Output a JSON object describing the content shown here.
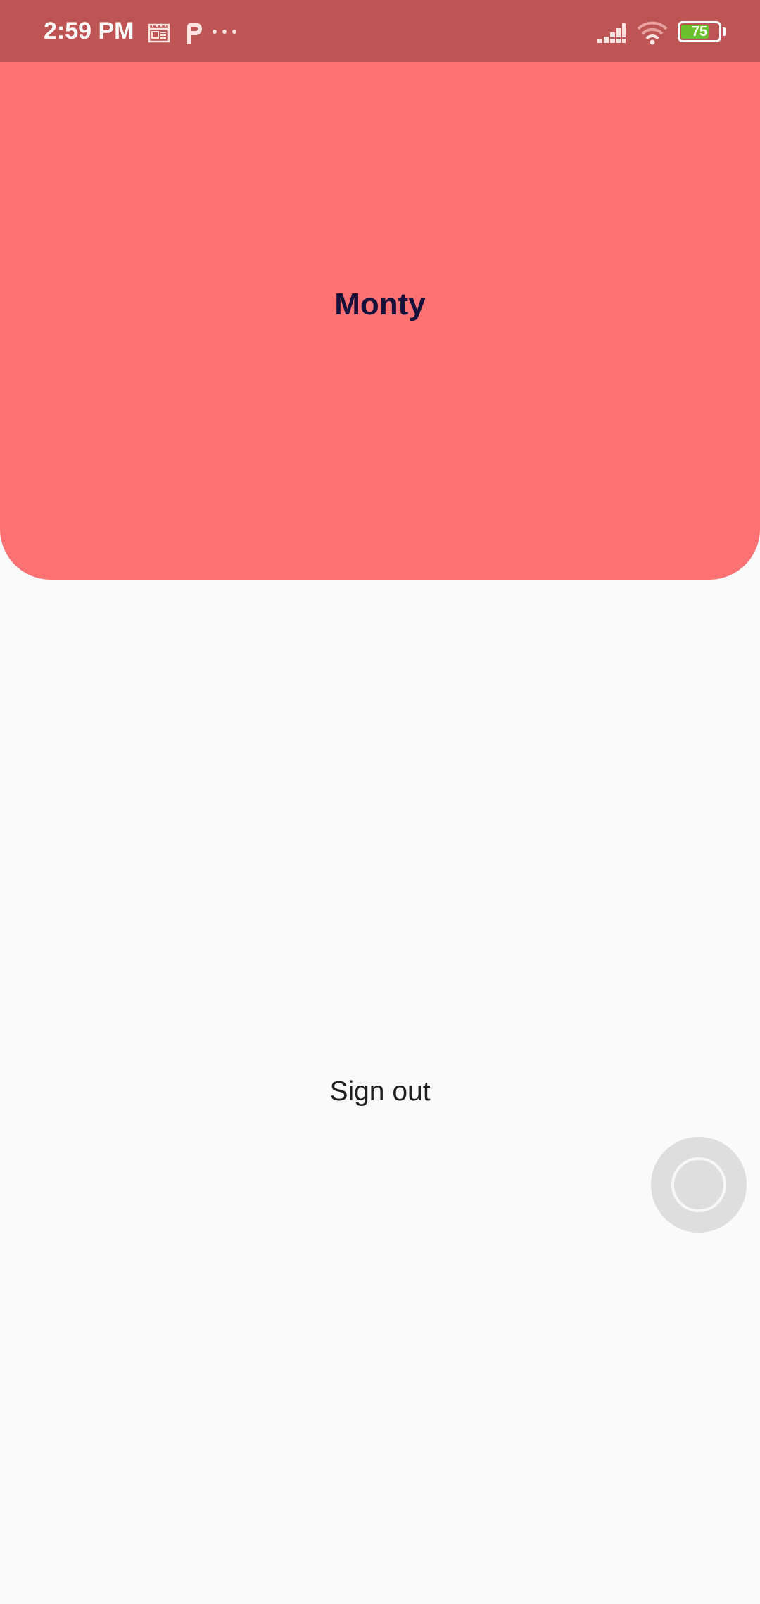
{
  "status_bar": {
    "time": "2:59 PM",
    "icons": {
      "notification_1": "calendar-icon",
      "notification_2": "p-app-icon",
      "more": "more-dots-icon",
      "signal": "signal-icon",
      "wifi": "wifi-icon",
      "battery": "battery-icon"
    },
    "battery_level": "75",
    "battery_fraction": 0.75,
    "colors": {
      "background": "#bd5555",
      "battery_fill": "#6bbf2a"
    }
  },
  "profile": {
    "name": "Monty",
    "colors": {
      "header_background": "#fe7274",
      "name_text": "#15113a"
    }
  },
  "actions": {
    "sign_out_label": "Sign out"
  },
  "floating": {
    "assistive_touch_icon": "assistive-touch-icon"
  },
  "page": {
    "background": "#fafafa"
  }
}
